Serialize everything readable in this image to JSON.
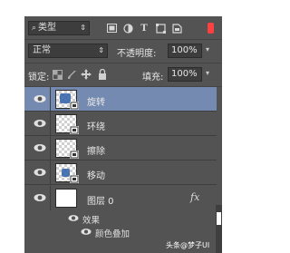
{
  "filter": {
    "kind_label": "类型",
    "search_icon": "search-icon",
    "dropdown_arrow": "⇕"
  },
  "filter_icons": [
    "image-filter-icon",
    "adjustment-filter-icon",
    "text-filter-icon",
    "shape-filter-icon",
    "smart-object-filter-icon"
  ],
  "filter_text_icon": "T",
  "blend": {
    "mode": "正常",
    "arrow": "⇕"
  },
  "opacity": {
    "label": "不透明度:",
    "value": "100%",
    "arrow": "▾"
  },
  "lock": {
    "label": "锁定:",
    "icons": [
      "lock-transparency-icon",
      "lock-paint-icon",
      "lock-position-icon",
      "lock-all-icon"
    ]
  },
  "fill": {
    "label": "填充:",
    "value": "100%",
    "arrow": "▾"
  },
  "layers": [
    {
      "name": "旋转",
      "selected": true,
      "thumb": "smart-object"
    },
    {
      "name": "环绕",
      "selected": false,
      "thumb": "smart-object"
    },
    {
      "name": "擦除",
      "selected": false,
      "thumb": "smart-object"
    },
    {
      "name": "移动",
      "selected": false,
      "thumb": "smart-object"
    },
    {
      "name": "图层 0",
      "selected": false,
      "thumb": "white",
      "fx": "fx"
    }
  ],
  "effects": {
    "label": "效果",
    "items": [
      "颜色叠加"
    ]
  },
  "watermark": "头条@梦子UI",
  "colors": {
    "panel": "#535353",
    "selected": "#758ab0",
    "input": "#3d3d3d",
    "switch": "#ff4040"
  }
}
